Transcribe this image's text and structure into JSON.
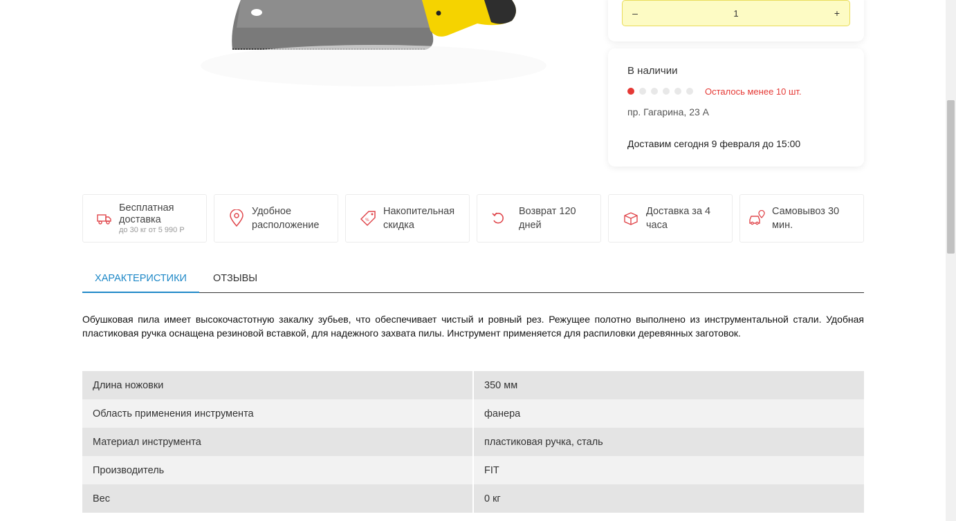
{
  "quantity": {
    "minus": "–",
    "value": "1",
    "plus": "+"
  },
  "stock": {
    "status": "В наличии",
    "level_filled": 1,
    "level_total": 6,
    "left_note": "Осталось менее 10 шт.",
    "address": "пр. Гагарина, 23 А",
    "delivery": "Доставим сегодня 9 февраля до 15:00"
  },
  "features": [
    {
      "title": "Бесплатная доставка",
      "sub": "до 30 кг от 5 990 Р",
      "icon": "truck-icon"
    },
    {
      "title": "Удобное расположение",
      "icon": "location-pin-icon"
    },
    {
      "title": "Накопительная скидка",
      "icon": "discount-tag-icon"
    },
    {
      "title": "Возврат 120 дней",
      "icon": "return-icon"
    },
    {
      "title": "Доставка за 4 часа",
      "icon": "box-icon"
    },
    {
      "title": "Самовывоз 30 мин.",
      "icon": "car-pin-icon"
    }
  ],
  "tabs": {
    "characteristics": "ХАРАКТЕРИСТИКИ",
    "reviews": "ОТЗЫВЫ"
  },
  "description": "Обушковая пила имеет высокочастотную закалку зубьев, что обеспечивает чистый и ровный рез. Режущее полотно выполнено из инструментальной стали. Удобная пластиковая ручка оснащена резиновой вставкой, для надежного захвата пилы. Инструмент применяется для распиловки деревянных заготовок.",
  "specs": [
    {
      "key": "Длина ножовки",
      "value": "350 мм"
    },
    {
      "key": "Область применения инструмента",
      "value": "фанера"
    },
    {
      "key": "Материал инструмента",
      "value": "пластиковая ручка, сталь"
    },
    {
      "key": "Производитель",
      "value": "FIT"
    },
    {
      "key": "Вес",
      "value": "0 кг"
    }
  ],
  "colors": {
    "accent": "#1e88c7",
    "alert": "#e53935",
    "qty_bg": "#fdfbc4",
    "icon": "#e0474c"
  }
}
